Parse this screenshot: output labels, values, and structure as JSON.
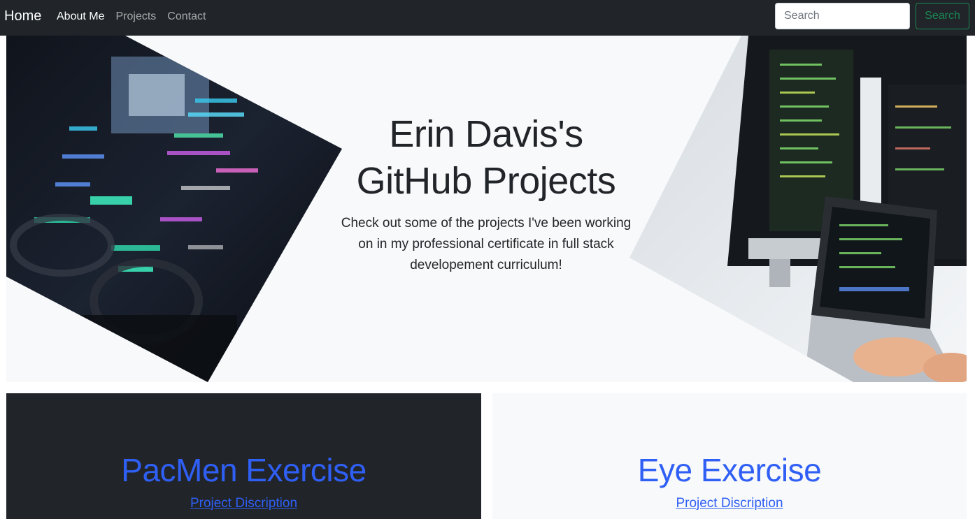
{
  "nav": {
    "brand": "Home",
    "links": [
      {
        "label": "About Me",
        "active": true
      },
      {
        "label": "Projects",
        "active": false
      },
      {
        "label": "Contact",
        "active": false
      }
    ],
    "search_placeholder": "Search",
    "search_button": "Search"
  },
  "hero": {
    "title_line1": "Erin Davis's",
    "title_line2": "GitHub Projects",
    "subtitle_line1": "Check out some of the projects I've been working",
    "subtitle_line2": "on in my professional certificate in full stack",
    "subtitle_line3": "developement curriculum!"
  },
  "cards": [
    {
      "title": "PacMen Exercise",
      "desc": "Project Discription"
    },
    {
      "title": "Eye Exercise",
      "desc": "Project Discription"
    }
  ],
  "colors": {
    "navbar_bg": "#212529",
    "accent_link": "#2f5ff5",
    "search_green": "#198754"
  }
}
